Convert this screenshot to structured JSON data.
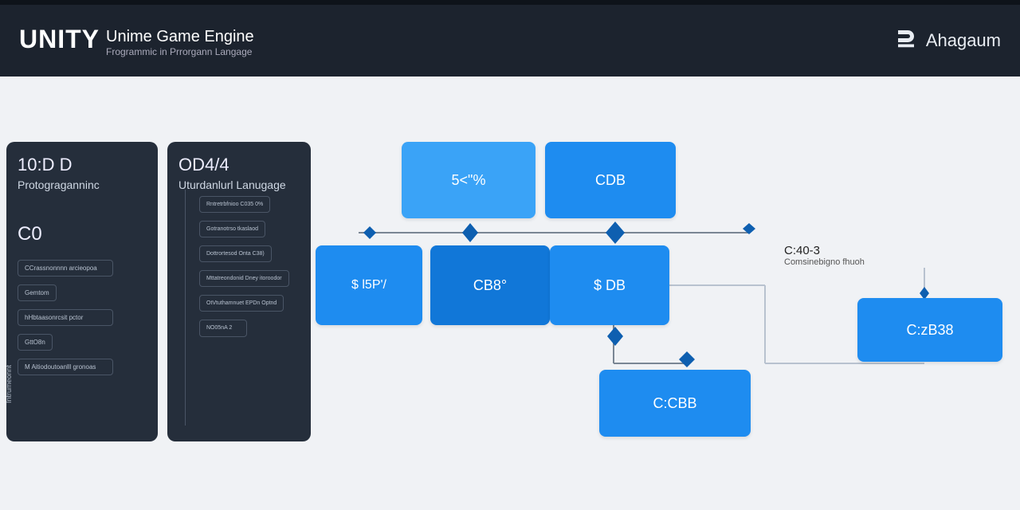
{
  "header": {
    "logo": "UNITY",
    "title": "Unime Game Engine",
    "subtitle": "Frogrammic in Prrorgann Langage"
  },
  "brand": {
    "name": "Ahagaum"
  },
  "panel1": {
    "title": "10:D D",
    "subtitle": "Protograganninc",
    "heading": "C0",
    "vertical_label": "Intrumeonnt",
    "items": [
      "CCrassnonnnn arcieopoa",
      "Gemtom",
      "hHbtaasonrcsit pctor",
      "GttO8n",
      "M Aitiodoutoanlll gronoas"
    ]
  },
  "panel2": {
    "title": "OD4/4",
    "subtitle": "Uturdanlurl Lanugage",
    "items": [
      "Rntretrbfnioo C035 0%",
      "Gotranotrso tkaslaod",
      "Dottrortesod Onta C38)",
      "Mttatreondonid Dney itoroodor",
      "OtVtuthamnuet EPDn Optnd",
      "NO05nA 2"
    ]
  },
  "nodes": {
    "top1": "5<\"%",
    "top2": "CDB",
    "mid0": "$ l5P'/",
    "mid1": "CB8°",
    "mid2": "$ DB",
    "bottom": "C:CBB",
    "far": "C:zB38"
  },
  "side_label": {
    "line1": "C:40-3",
    "line2": "Comsinebigno fhuoh"
  }
}
